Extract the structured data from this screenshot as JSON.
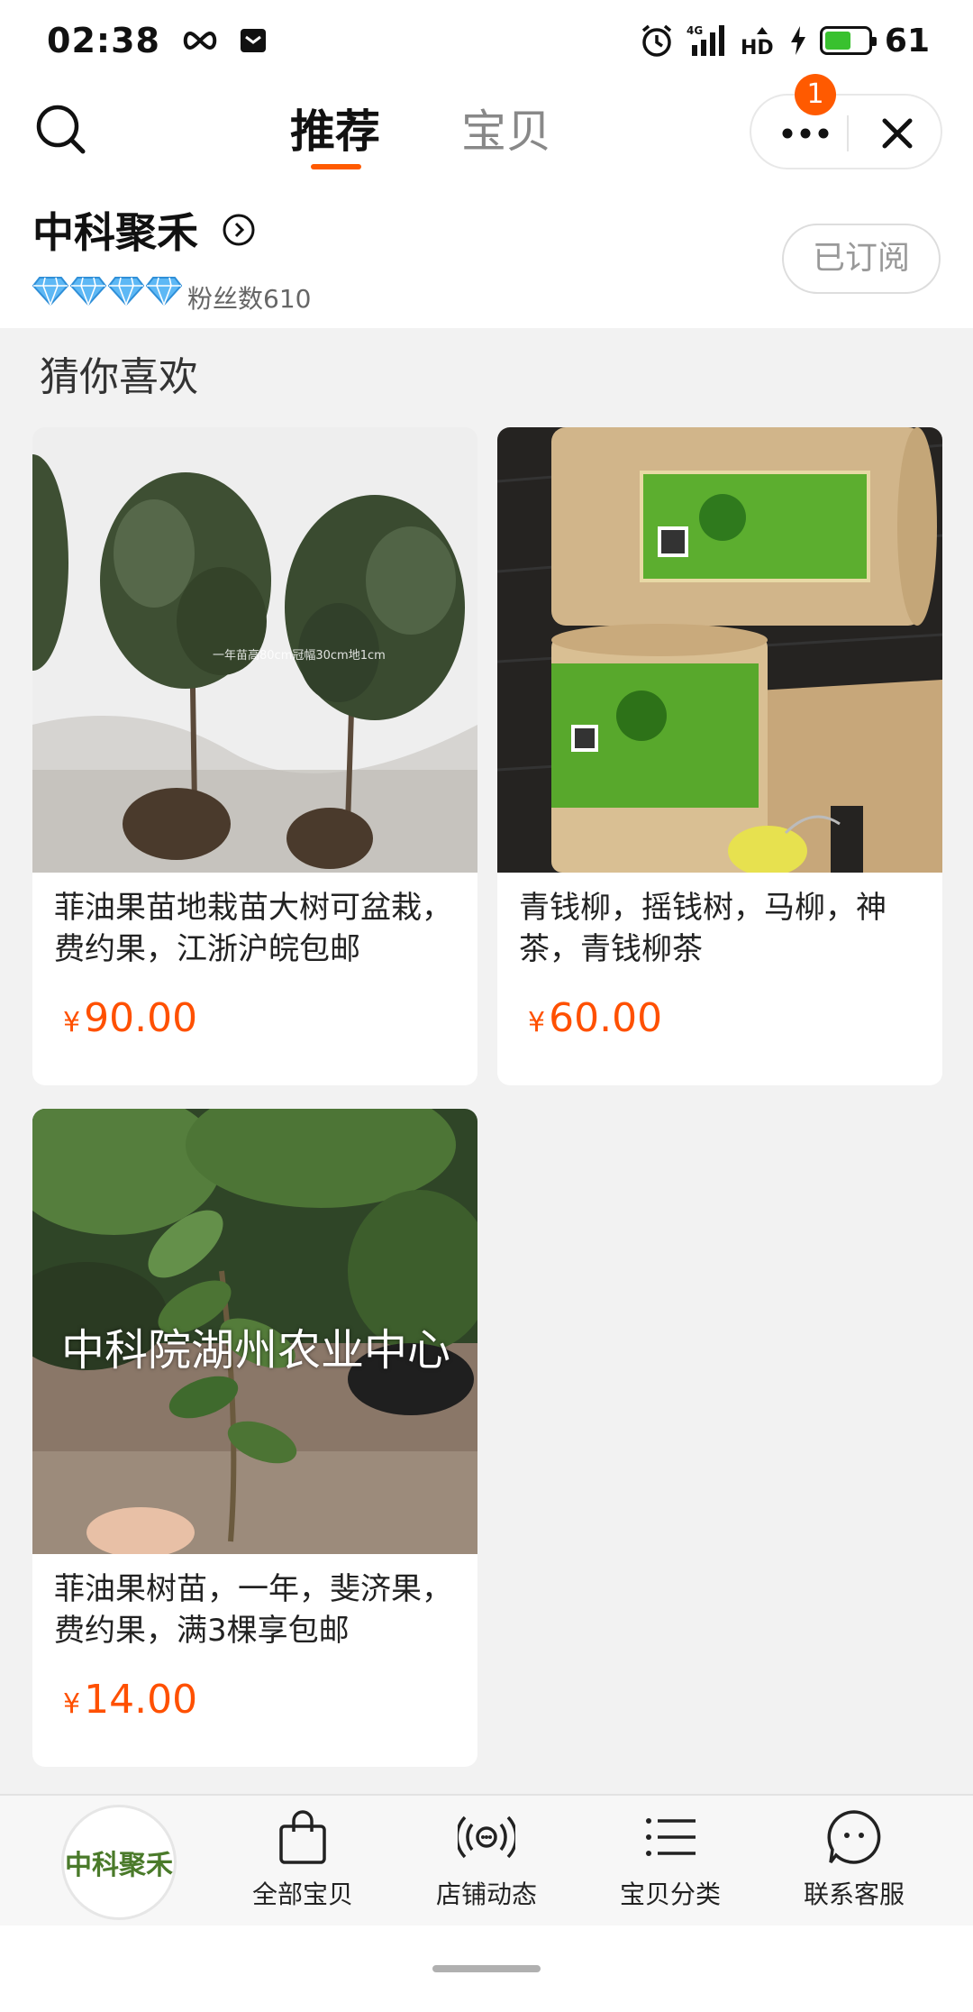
{
  "status_bar": {
    "time": "02:38",
    "battery_percent": "61",
    "network_label": "4G",
    "hd_label": "HD"
  },
  "header": {
    "tabs": [
      {
        "label": "推荐",
        "active": true
      },
      {
        "label": "宝贝",
        "active": false
      }
    ],
    "badge_count": "1",
    "accent_color": "#ff5a00"
  },
  "shop": {
    "name": "中科聚禾",
    "fans": "粉丝数610",
    "subscribe_label": "已订阅",
    "diamond_count": 4
  },
  "section_title": "猜你喜欢",
  "products": [
    {
      "title": "菲油果苗地栽苗大树可盆栽，费约果，江浙沪皖包邮",
      "currency": "¥",
      "price": "90.00",
      "photo_caption": "一年苗高80cm冠幅30cm地1cm"
    },
    {
      "title": "青钱柳，摇钱树，马柳，神茶，青钱柳茶",
      "currency": "¥",
      "price": "60.00"
    },
    {
      "title": "菲油果树苗，一年，斐济果，费约果，满3棵享包邮",
      "currency": "¥",
      "price": "14.00",
      "overlay_text": "中科院湖州农业中心"
    }
  ],
  "bottom_nav": {
    "logo_text": "中科聚禾",
    "items": [
      {
        "label": "全部宝贝",
        "icon": "shopping-bag-icon"
      },
      {
        "label": "店铺动态",
        "icon": "broadcast-icon"
      },
      {
        "label": "宝贝分类",
        "icon": "list-icon"
      },
      {
        "label": "联系客服",
        "icon": "chat-bubble-icon"
      }
    ]
  }
}
